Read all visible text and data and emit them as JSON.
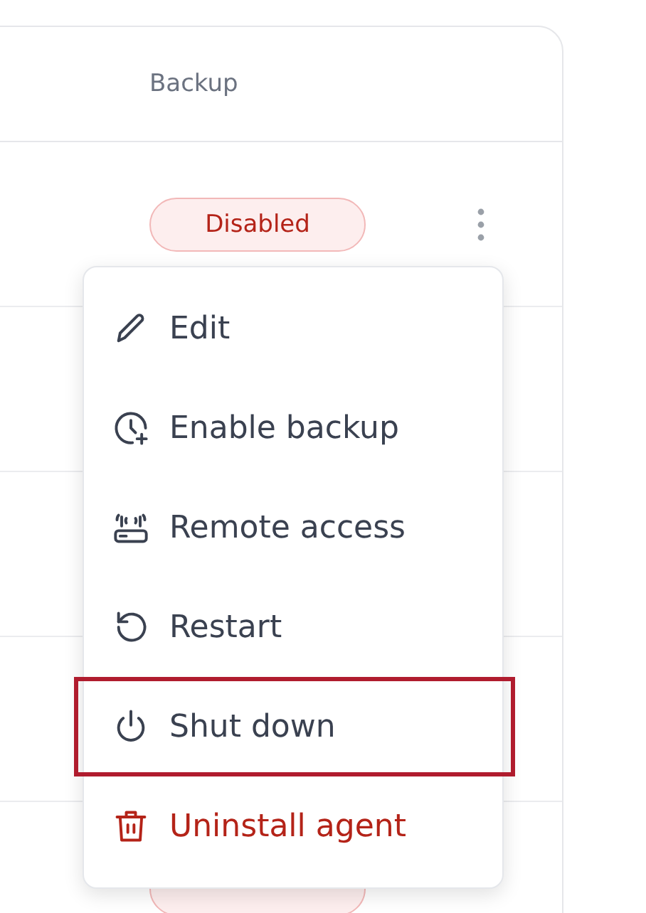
{
  "table": {
    "columns": [
      "Backup"
    ],
    "rows": [
      {
        "backup": "Disabled"
      }
    ]
  },
  "menu": {
    "items": [
      {
        "label": "Edit",
        "kind": "normal",
        "highlighted": false
      },
      {
        "label": "Enable backup",
        "kind": "normal",
        "highlighted": false
      },
      {
        "label": "Remote access",
        "kind": "normal",
        "highlighted": false
      },
      {
        "label": "Restart",
        "kind": "normal",
        "highlighted": false
      },
      {
        "label": "Shut down",
        "kind": "normal",
        "highlighted": true
      },
      {
        "label": "Uninstall agent",
        "kind": "danger",
        "highlighted": false
      }
    ]
  }
}
